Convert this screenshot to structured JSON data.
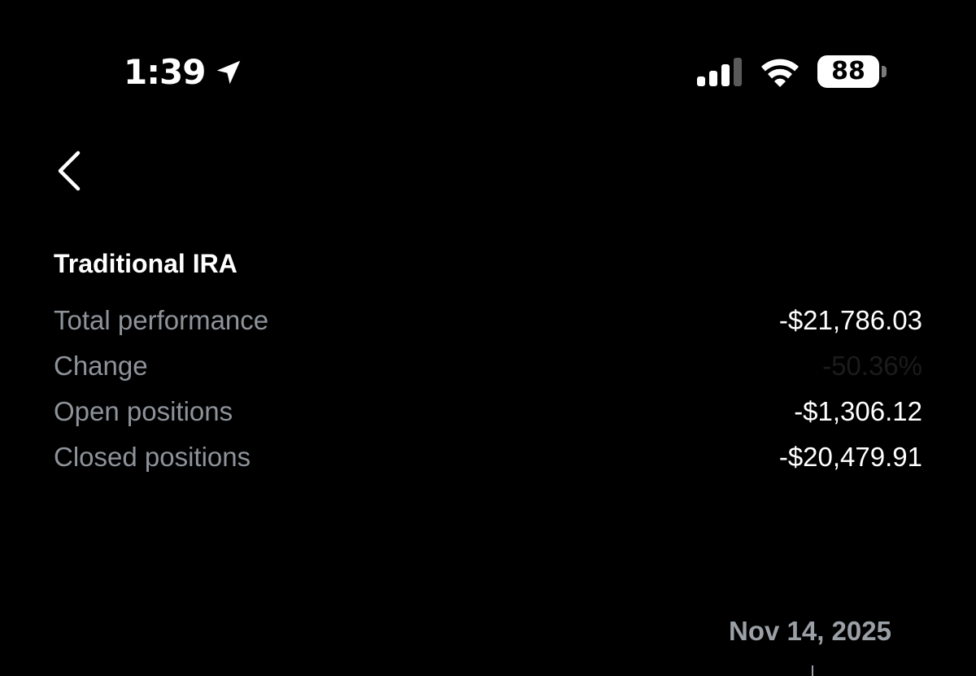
{
  "status_bar": {
    "time": "1:39",
    "battery": "88",
    "icons": [
      "location-arrow-icon",
      "cellular-signal-icon",
      "wifi-icon",
      "battery-icon"
    ]
  },
  "nav": {
    "back_icon": "chevron-left-icon"
  },
  "account": {
    "title": "Traditional IRA",
    "metrics": [
      {
        "label": "Total performance",
        "value": "-$21,786.03"
      },
      {
        "label": "Change",
        "value": "-50.36%"
      },
      {
        "label": "Open positions",
        "value": "-$1,306.12"
      },
      {
        "label": "Closed positions",
        "value": "-$20,479.91"
      }
    ]
  },
  "chart": {
    "selected_date": "Nov 14, 2025"
  },
  "colors": {
    "background": "#000000",
    "label": "#8e939a",
    "value": "#ffffff",
    "change_value": "#1b1b1b",
    "date": "#9aa0a6"
  }
}
